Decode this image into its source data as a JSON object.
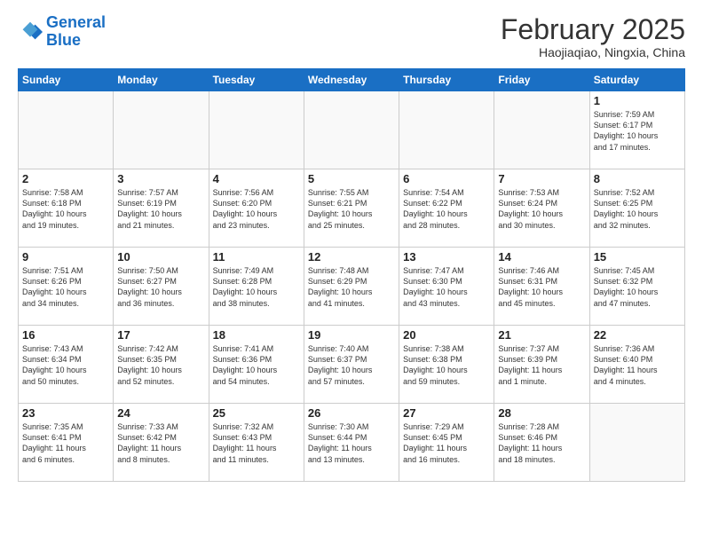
{
  "header": {
    "logo_line1": "General",
    "logo_line2": "Blue",
    "month": "February 2025",
    "location": "Haojiaqiao, Ningxia, China"
  },
  "weekdays": [
    "Sunday",
    "Monday",
    "Tuesday",
    "Wednesday",
    "Thursday",
    "Friday",
    "Saturday"
  ],
  "weeks": [
    [
      {
        "day": "",
        "info": ""
      },
      {
        "day": "",
        "info": ""
      },
      {
        "day": "",
        "info": ""
      },
      {
        "day": "",
        "info": ""
      },
      {
        "day": "",
        "info": ""
      },
      {
        "day": "",
        "info": ""
      },
      {
        "day": "1",
        "info": "Sunrise: 7:59 AM\nSunset: 6:17 PM\nDaylight: 10 hours\nand 17 minutes."
      }
    ],
    [
      {
        "day": "2",
        "info": "Sunrise: 7:58 AM\nSunset: 6:18 PM\nDaylight: 10 hours\nand 19 minutes."
      },
      {
        "day": "3",
        "info": "Sunrise: 7:57 AM\nSunset: 6:19 PM\nDaylight: 10 hours\nand 21 minutes."
      },
      {
        "day": "4",
        "info": "Sunrise: 7:56 AM\nSunset: 6:20 PM\nDaylight: 10 hours\nand 23 minutes."
      },
      {
        "day": "5",
        "info": "Sunrise: 7:55 AM\nSunset: 6:21 PM\nDaylight: 10 hours\nand 25 minutes."
      },
      {
        "day": "6",
        "info": "Sunrise: 7:54 AM\nSunset: 6:22 PM\nDaylight: 10 hours\nand 28 minutes."
      },
      {
        "day": "7",
        "info": "Sunrise: 7:53 AM\nSunset: 6:24 PM\nDaylight: 10 hours\nand 30 minutes."
      },
      {
        "day": "8",
        "info": "Sunrise: 7:52 AM\nSunset: 6:25 PM\nDaylight: 10 hours\nand 32 minutes."
      }
    ],
    [
      {
        "day": "9",
        "info": "Sunrise: 7:51 AM\nSunset: 6:26 PM\nDaylight: 10 hours\nand 34 minutes."
      },
      {
        "day": "10",
        "info": "Sunrise: 7:50 AM\nSunset: 6:27 PM\nDaylight: 10 hours\nand 36 minutes."
      },
      {
        "day": "11",
        "info": "Sunrise: 7:49 AM\nSunset: 6:28 PM\nDaylight: 10 hours\nand 38 minutes."
      },
      {
        "day": "12",
        "info": "Sunrise: 7:48 AM\nSunset: 6:29 PM\nDaylight: 10 hours\nand 41 minutes."
      },
      {
        "day": "13",
        "info": "Sunrise: 7:47 AM\nSunset: 6:30 PM\nDaylight: 10 hours\nand 43 minutes."
      },
      {
        "day": "14",
        "info": "Sunrise: 7:46 AM\nSunset: 6:31 PM\nDaylight: 10 hours\nand 45 minutes."
      },
      {
        "day": "15",
        "info": "Sunrise: 7:45 AM\nSunset: 6:32 PM\nDaylight: 10 hours\nand 47 minutes."
      }
    ],
    [
      {
        "day": "16",
        "info": "Sunrise: 7:43 AM\nSunset: 6:34 PM\nDaylight: 10 hours\nand 50 minutes."
      },
      {
        "day": "17",
        "info": "Sunrise: 7:42 AM\nSunset: 6:35 PM\nDaylight: 10 hours\nand 52 minutes."
      },
      {
        "day": "18",
        "info": "Sunrise: 7:41 AM\nSunset: 6:36 PM\nDaylight: 10 hours\nand 54 minutes."
      },
      {
        "day": "19",
        "info": "Sunrise: 7:40 AM\nSunset: 6:37 PM\nDaylight: 10 hours\nand 57 minutes."
      },
      {
        "day": "20",
        "info": "Sunrise: 7:38 AM\nSunset: 6:38 PM\nDaylight: 10 hours\nand 59 minutes."
      },
      {
        "day": "21",
        "info": "Sunrise: 7:37 AM\nSunset: 6:39 PM\nDaylight: 11 hours\nand 1 minute."
      },
      {
        "day": "22",
        "info": "Sunrise: 7:36 AM\nSunset: 6:40 PM\nDaylight: 11 hours\nand 4 minutes."
      }
    ],
    [
      {
        "day": "23",
        "info": "Sunrise: 7:35 AM\nSunset: 6:41 PM\nDaylight: 11 hours\nand 6 minutes."
      },
      {
        "day": "24",
        "info": "Sunrise: 7:33 AM\nSunset: 6:42 PM\nDaylight: 11 hours\nand 8 minutes."
      },
      {
        "day": "25",
        "info": "Sunrise: 7:32 AM\nSunset: 6:43 PM\nDaylight: 11 hours\nand 11 minutes."
      },
      {
        "day": "26",
        "info": "Sunrise: 7:30 AM\nSunset: 6:44 PM\nDaylight: 11 hours\nand 13 minutes."
      },
      {
        "day": "27",
        "info": "Sunrise: 7:29 AM\nSunset: 6:45 PM\nDaylight: 11 hours\nand 16 minutes."
      },
      {
        "day": "28",
        "info": "Sunrise: 7:28 AM\nSunset: 6:46 PM\nDaylight: 11 hours\nand 18 minutes."
      },
      {
        "day": "",
        "info": ""
      }
    ]
  ]
}
